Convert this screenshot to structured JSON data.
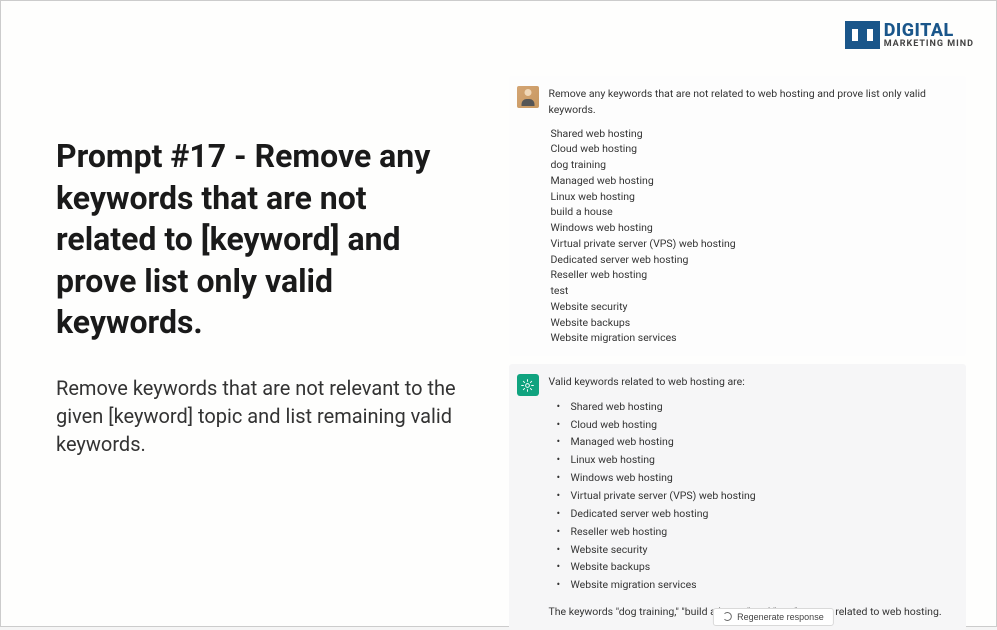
{
  "logo": {
    "top": "DIGITAL",
    "bottom": "MARKETING MIND"
  },
  "left": {
    "title": "Prompt #17 - Remove any keywords that are not related to [keyword] and prove list only valid keywords.",
    "description": "Remove keywords that are not relevant to the given [keyword] topic and list remaining valid keywords."
  },
  "chat": {
    "user": {
      "prompt": "Remove any keywords that are not related to web hosting and prove list only valid keywords.",
      "keywords": [
        "Shared web hosting",
        "Cloud web hosting",
        "dog training",
        "Managed web hosting",
        "Linux web hosting",
        "build a house",
        "Windows web hosting",
        "Virtual private server (VPS) web hosting",
        "Dedicated server web hosting",
        "Reseller web hosting",
        "test",
        "Website security",
        "Website backups",
        "Website migration services"
      ]
    },
    "assistant": {
      "intro": "Valid keywords related to web hosting are:",
      "valid_keywords": [
        "Shared web hosting",
        "Cloud web hosting",
        "Managed web hosting",
        "Linux web hosting",
        "Windows web hosting",
        "Virtual private server (VPS) web hosting",
        "Dedicated server web hosting",
        "Reseller web hosting",
        "Website security",
        "Website backups",
        "Website migration services"
      ],
      "conclusion": "The keywords \"dog training,\" \"build a house\" and \"test\" are not related to web hosting."
    },
    "regenerate_label": "Regenerate response"
  }
}
